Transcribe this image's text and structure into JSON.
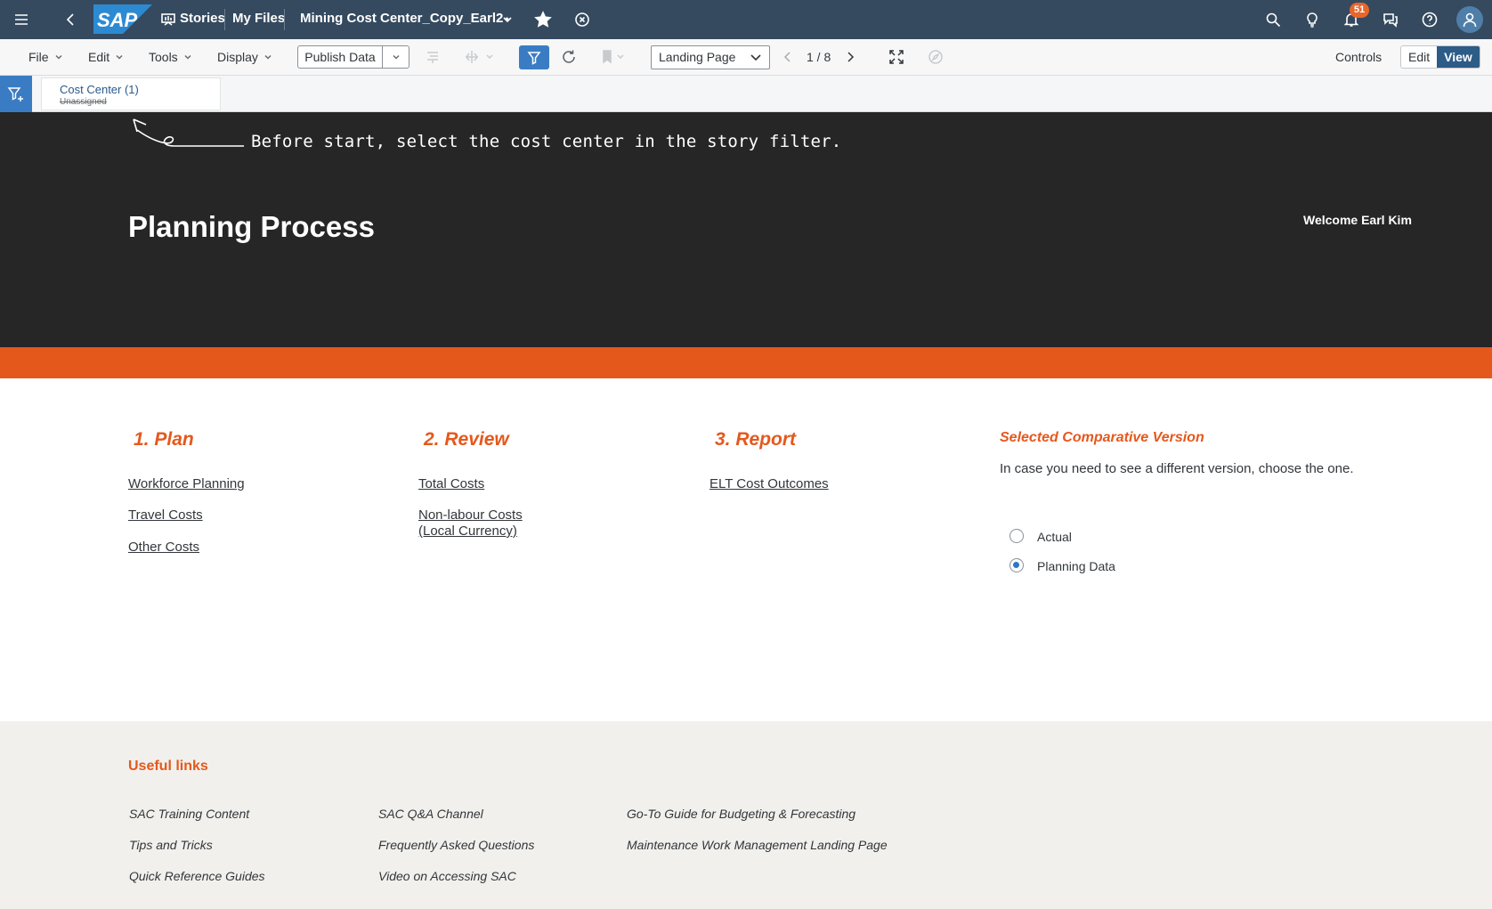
{
  "shell": {
    "logo_text": "SAP",
    "stories_label": "Stories",
    "my_files_label": "My Files",
    "story_title": "Mining Cost Center_Copy_Earl2",
    "unsaved_marker": "•",
    "notification_count": "51"
  },
  "toolbar": {
    "menus": [
      "File",
      "Edit",
      "Tools",
      "Display"
    ],
    "publish_label": "Publish Data",
    "page_select": "Landing Page",
    "page_indicator": "1 / 8",
    "controls_label": "Controls",
    "edit_label": "Edit",
    "view_label": "View"
  },
  "filter": {
    "chip_title": "Cost Center (1)",
    "chip_value": "Unassigned"
  },
  "hero": {
    "hint": "Before start, select the cost center in the story filter.",
    "title": "Planning Process",
    "welcome": "Welcome Earl Kim"
  },
  "sections": {
    "plan": {
      "heading": "1. Plan",
      "links": [
        "Workforce Planning",
        "Travel Costs",
        "Other Costs"
      ]
    },
    "review": {
      "heading": "2. Review",
      "links": [
        "Total Costs",
        "Non-labour Costs",
        "(Local Currency)"
      ]
    },
    "report": {
      "heading": "3. Report",
      "links": [
        "ELT Cost Outcomes"
      ]
    },
    "comparative": {
      "heading": "Selected Comparative Version",
      "description": "In case you need to see a different version, choose the one.",
      "options": [
        "Actual",
        "Planning Data"
      ],
      "selected": "Planning Data"
    }
  },
  "footer": {
    "heading": "Useful links",
    "col1": [
      "SAC Training Content",
      "Tips and Tricks",
      "Quick Reference Guides"
    ],
    "col2": [
      "SAC Q&A Channel",
      "Frequently Asked Questions",
      "Video on Accessing SAC"
    ],
    "col3": [
      "Go-To Guide for Budgeting & Forecasting",
      "Maintenance Work Management Landing Page"
    ]
  },
  "colors": {
    "shell_bg": "#354a5f",
    "accent_orange": "#e5581c",
    "hero_bg": "#262626",
    "primary_blue": "#3a7cc3"
  }
}
